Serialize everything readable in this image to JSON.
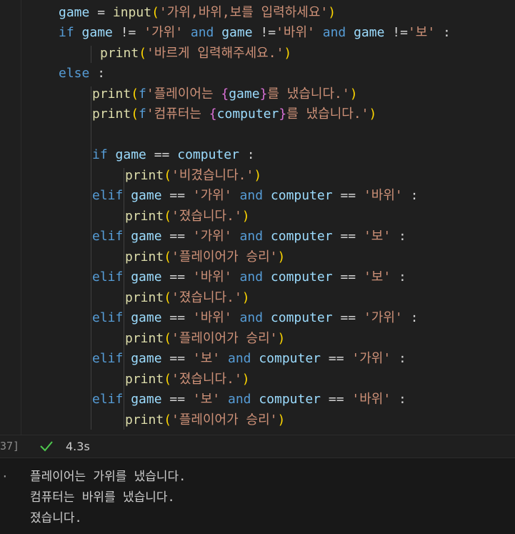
{
  "cell": {
    "execution_count": "37]",
    "status_icon": "check-icon",
    "duration": "4.3s"
  },
  "code": {
    "l1": {
      "var": "game",
      "eq": " = ",
      "fn": "input",
      "open": "(",
      "str": "'가위,바위,보를 입력하세요'",
      "close": ")"
    },
    "l2": {
      "kw_if": "if",
      "var1": " game ",
      "op1": "!= ",
      "s1": "'가위'",
      "kw_and1": " and ",
      "var2": "game ",
      "op2": "!=",
      "s2": "'바위'",
      "kw_and2": " and ",
      "var3": "game ",
      "op3": "!=",
      "s3": "'보'",
      "colon": " :"
    },
    "l3": {
      "fn": "print",
      "open": "(",
      "str": "'바르게 입력해주세요.'",
      "close": ")"
    },
    "l4": {
      "kw": "else",
      "colon": " :"
    },
    "l5": {
      "fn": "print",
      "open": "(",
      "f": "f",
      "s1": "'플레이어는 ",
      "b_open": "{",
      "var": "game",
      "b_close": "}",
      "s2": "를 냈습니다.'",
      "close": ")"
    },
    "l6": {
      "fn": "print",
      "open": "(",
      "f": "f",
      "s1": "'컴퓨터는 ",
      "b_open": "{",
      "var": "computer",
      "b_close": "}",
      "s2": "를 냈습니다.'",
      "close": ")"
    },
    "l7": {
      "kw": "if",
      "var1": " game ",
      "op": "== ",
      "var2": "computer",
      "colon": " :"
    },
    "l8": {
      "fn": "print",
      "open": "(",
      "str": "'비겼습니다.'",
      "close": ")"
    },
    "l9": {
      "kw": "elif",
      "var1": " game ",
      "op1": "== ",
      "s1": "'가위'",
      "kw_and": " and ",
      "var2": "computer ",
      "op2": "== ",
      "s2": "'바위'",
      "colon": " :"
    },
    "l10": {
      "fn": "print",
      "open": "(",
      "str": "'졌습니다.'",
      "close": ")"
    },
    "l11": {
      "kw": "elif",
      "var1": " game ",
      "op1": "== ",
      "s1": "'가위'",
      "kw_and": " and ",
      "var2": "computer ",
      "op2": "== ",
      "s2": "'보'",
      "colon": " :"
    },
    "l12": {
      "fn": "print",
      "open": "(",
      "str": "'플레이어가 승리'",
      "close": ")"
    },
    "l13": {
      "kw": "elif",
      "var1": " game ",
      "op1": "== ",
      "s1": "'바위'",
      "kw_and": " and ",
      "var2": "computer ",
      "op2": "== ",
      "s2": "'보'",
      "colon": " :"
    },
    "l14": {
      "fn": "print",
      "open": "(",
      "str": "'졌습니다.'",
      "close": ")"
    },
    "l15": {
      "kw": "elif",
      "var1": " game ",
      "op1": "== ",
      "s1": "'바위'",
      "kw_and": " and ",
      "var2": "computer ",
      "op2": "== ",
      "s2": "'가위'",
      "colon": " :"
    },
    "l16": {
      "fn": "print",
      "open": "(",
      "str": "'플레이어가 승리'",
      "close": ")"
    },
    "l17": {
      "kw": "elif",
      "var1": " game ",
      "op1": "== ",
      "s1": "'보'",
      "kw_and": " and ",
      "var2": "computer ",
      "op2": "== ",
      "s2": "'가위'",
      "colon": " :"
    },
    "l18": {
      "fn": "print",
      "open": "(",
      "str": "'졌습니다.'",
      "close": ")"
    },
    "l19": {
      "kw": "elif",
      "var1": " game ",
      "op1": "== ",
      "s1": "'보'",
      "kw_and": " and ",
      "var2": "computer ",
      "op2": "== ",
      "s2": "'바위'",
      "colon": " :"
    },
    "l20": {
      "fn": "print",
      "open": "(",
      "str": "'플레이어가 승리'",
      "close": ")"
    }
  },
  "output": {
    "bullet": "·",
    "lines": [
      "플레이어는 가위를 냈습니다.",
      "컴퓨터는 바위를 냈습니다.",
      "졌습니다."
    ]
  },
  "colors": {
    "background": "#1f1f1f",
    "keyword": "#569cd6",
    "function": "#dcdcaa",
    "variable": "#9cdcfe",
    "string": "#ce9178",
    "bracket_gold": "#ffd700",
    "bracket_magenta": "#da70d6",
    "success": "#4ec94e"
  }
}
